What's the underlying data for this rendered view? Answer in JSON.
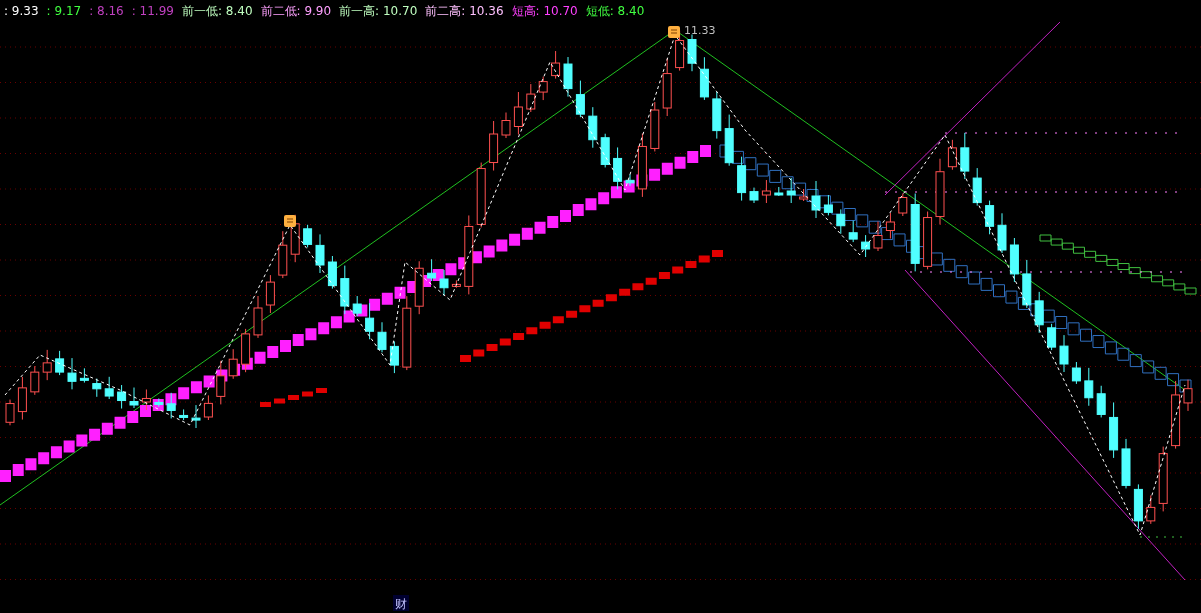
{
  "indicators": [
    {
      "text": ": 9.33",
      "color": "#ffffff"
    },
    {
      "text": ": 9.17",
      "color": "#40ff40"
    },
    {
      "text": ": 8.16",
      "color": "#c040c0"
    },
    {
      "text": ": 11.99",
      "color": "#c040c0"
    },
    {
      "text": "前一低: 8.40",
      "color": "#c0ffc0"
    },
    {
      "text": "前二低: 9.90",
      "color": "#ffa0ff"
    },
    {
      "text": "前一高: 10.70",
      "color": "#c0ffc0"
    },
    {
      "text": "前二高: 10.36",
      "color": "#ffc0ff"
    },
    {
      "text": "短高: 10.70",
      "color": "#ff40ff"
    },
    {
      "text": "短低: 8.40",
      "color": "#40ff40"
    }
  ],
  "chart": {
    "peak_label": "11.33",
    "bottom_tag": "财"
  }
}
